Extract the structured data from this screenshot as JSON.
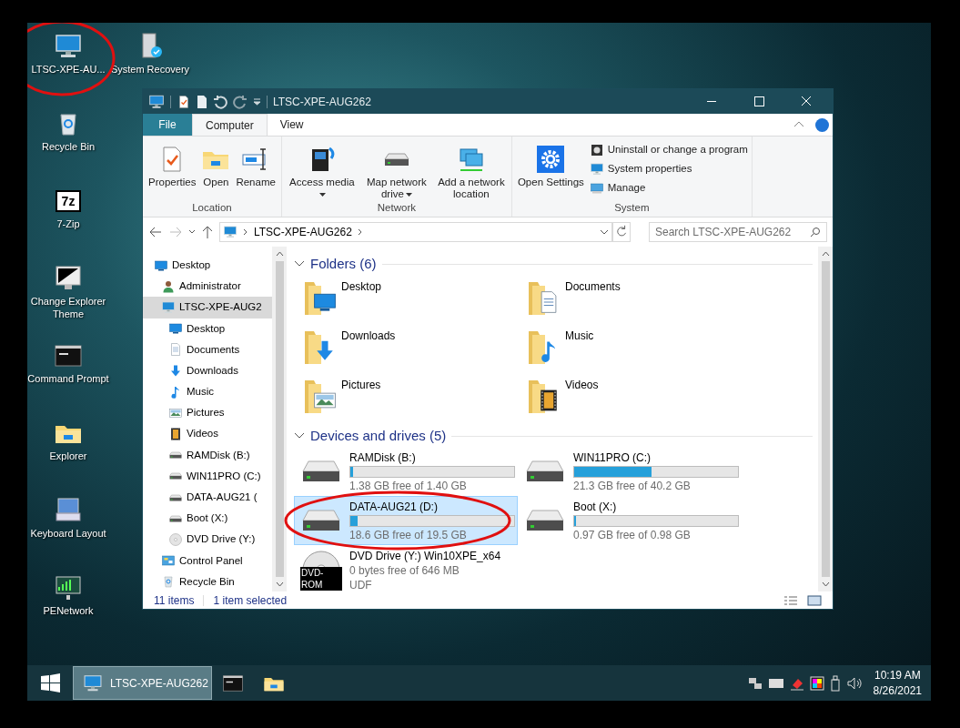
{
  "desktop_icons": [
    {
      "label": "LTSC-XPE-AU...",
      "kind": "computer"
    },
    {
      "label": "Recycle Bin",
      "kind": "recycle"
    },
    {
      "label": "7-Zip",
      "kind": "sevenzip",
      "logo_text": "7z"
    },
    {
      "label": "Change Explorer Theme",
      "kind": "monitor"
    },
    {
      "label": "Command Prompt",
      "kind": "cmd"
    },
    {
      "label": "Explorer",
      "kind": "folder"
    },
    {
      "label": "Keyboard Layout",
      "kind": "keyboard"
    },
    {
      "label": "PENetwork",
      "kind": "network"
    },
    {
      "label": "System Recovery",
      "kind": "recovery"
    }
  ],
  "annotations": [
    {
      "kind": "ellipse"
    },
    {
      "kind": "ellipse"
    }
  ],
  "window": {
    "title": "LTSC-XPE-AUG262",
    "tabs": [
      {
        "label": "File",
        "kind": "file",
        "selected": false
      },
      {
        "label": "Computer",
        "kind": "tab",
        "selected": true
      },
      {
        "label": "View",
        "kind": "tab",
        "selected": false
      }
    ],
    "ribbon": [
      {
        "label": "Location",
        "large": [
          {
            "label": "Properties",
            "kind": "properties",
            "dropdown": false
          },
          {
            "label": "Open",
            "kind": "open",
            "dropdown": false
          },
          {
            "label": "Rename",
            "kind": "rename",
            "dropdown": false
          }
        ]
      },
      {
        "label": "Network",
        "large": [
          {
            "label": "Access media",
            "kind": "media",
            "dropdown": true
          },
          {
            "label": "Map network drive",
            "kind": "mapdrive",
            "dropdown": true
          },
          {
            "label": "Add a network location",
            "kind": "netloc",
            "dropdown": false
          }
        ]
      },
      {
        "label": "System",
        "large": [
          {
            "label": "Open Settings",
            "kind": "settings",
            "dropdown": false
          }
        ],
        "small": [
          {
            "label": "Uninstall or change a program",
            "kind": "uninstall"
          },
          {
            "label": "System properties",
            "kind": "sysprops"
          },
          {
            "label": "Manage",
            "kind": "manage"
          }
        ]
      }
    ],
    "address": {
      "path": "LTSC-XPE-AUG262"
    },
    "search": {
      "placeholder": "Search LTSC-XPE-AUG262"
    },
    "nav": [
      {
        "label": "Desktop",
        "kind": "desktop",
        "selected": false,
        "children": [
          {
            "label": "Administrator",
            "kind": "user",
            "selected": false
          },
          {
            "label": "LTSC-XPE-AUG2",
            "kind": "computer",
            "selected": true,
            "children": [
              {
                "label": "Desktop",
                "kind": "desktop",
                "selected": false
              },
              {
                "label": "Documents",
                "kind": "documents",
                "selected": false
              },
              {
                "label": "Downloads",
                "kind": "downloads",
                "selected": false
              },
              {
                "label": "Music",
                "kind": "music",
                "selected": false
              },
              {
                "label": "Pictures",
                "kind": "pictures",
                "selected": false
              },
              {
                "label": "Videos",
                "kind": "videos",
                "selected": false
              },
              {
                "label": "RAMDisk (B:)",
                "kind": "drive",
                "selected": false
              },
              {
                "label": "WIN11PRO (C:)",
                "kind": "drive",
                "selected": false
              },
              {
                "label": "DATA-AUG21 (",
                "kind": "drive",
                "selected": false
              },
              {
                "label": "Boot (X:)",
                "kind": "drive",
                "selected": false
              },
              {
                "label": "DVD Drive (Y:)",
                "kind": "dvd",
                "selected": false
              }
            ]
          },
          {
            "label": "Control Panel",
            "kind": "control",
            "selected": false
          },
          {
            "label": "Recycle Bin",
            "kind": "recycle",
            "selected": false
          }
        ]
      }
    ],
    "folders": {
      "header": "Folders (6)",
      "items": [
        {
          "label": "Desktop",
          "kind": "desktop"
        },
        {
          "label": "Documents",
          "kind": "documents"
        },
        {
          "label": "Downloads",
          "kind": "downloads"
        },
        {
          "label": "Music",
          "kind": "music"
        },
        {
          "label": "Pictures",
          "kind": "pictures"
        },
        {
          "label": "Videos",
          "kind": "videos"
        }
      ]
    },
    "drives": {
      "header": "Devices and drives (5)",
      "items": [
        {
          "kind": "disk",
          "name": "RAMDisk (B:)",
          "level": 0.015,
          "free": "1.38 GB free of 1.40 GB",
          "selected": false
        },
        {
          "kind": "disk",
          "name": "WIN11PRO (C:)",
          "level": 0.47,
          "free": "21.3 GB free of 40.2 GB",
          "selected": false
        },
        {
          "kind": "disk",
          "name": "DATA-AUG21 (D:)",
          "level": 0.046,
          "free": "18.6 GB free of 19.5 GB",
          "selected": true
        },
        {
          "kind": "disk",
          "name": "Boot (X:)",
          "level": 0.01,
          "free": "0.97 GB free of 0.98 GB",
          "selected": false
        },
        {
          "kind": "optical",
          "name": "DVD Drive (Y:) Win10XPE_x64",
          "free": "0 bytes free of 646 MB",
          "filesystem": "UDF",
          "badge": "DVD-ROM",
          "selected": false
        }
      ]
    },
    "status": {
      "count": "11 items",
      "selection": "1 item selected"
    }
  },
  "taskbar": {
    "windows": [
      {
        "label": "LTSC-XPE-AUG262",
        "kind": "explorer",
        "selected": true
      }
    ],
    "pinned": [
      {
        "kind": "cmd"
      },
      {
        "kind": "folder"
      }
    ],
    "time": "10:19 AM",
    "date": "8/26/2021"
  }
}
